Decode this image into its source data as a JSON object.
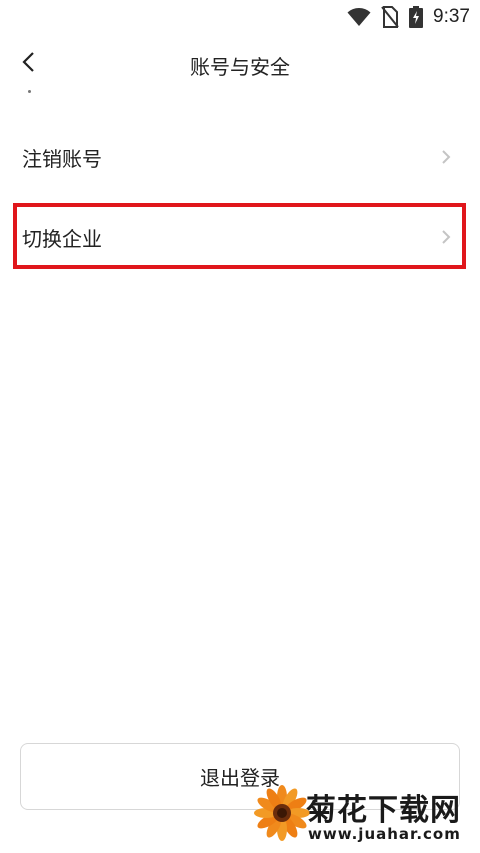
{
  "status_bar": {
    "time": "9:37",
    "icons": [
      "wifi-icon",
      "no-sim-icon",
      "battery-charging-icon"
    ]
  },
  "header": {
    "back_icon": "chevron-left-icon",
    "title": "账号与安全"
  },
  "list": {
    "items": [
      {
        "label": "注销账号",
        "icon": "chevron-right-icon"
      },
      {
        "label": "切换企业",
        "icon": "chevron-right-icon",
        "highlighted": true
      }
    ]
  },
  "footer": {
    "logout_label": "退出登录"
  },
  "watermark": {
    "title": "菊花下载网",
    "url": "www.juahar.com"
  },
  "colors": {
    "highlight": "#e0161b",
    "text": "#222222",
    "chevron": "#c4c4c4",
    "button_border": "#d7d7d7"
  }
}
